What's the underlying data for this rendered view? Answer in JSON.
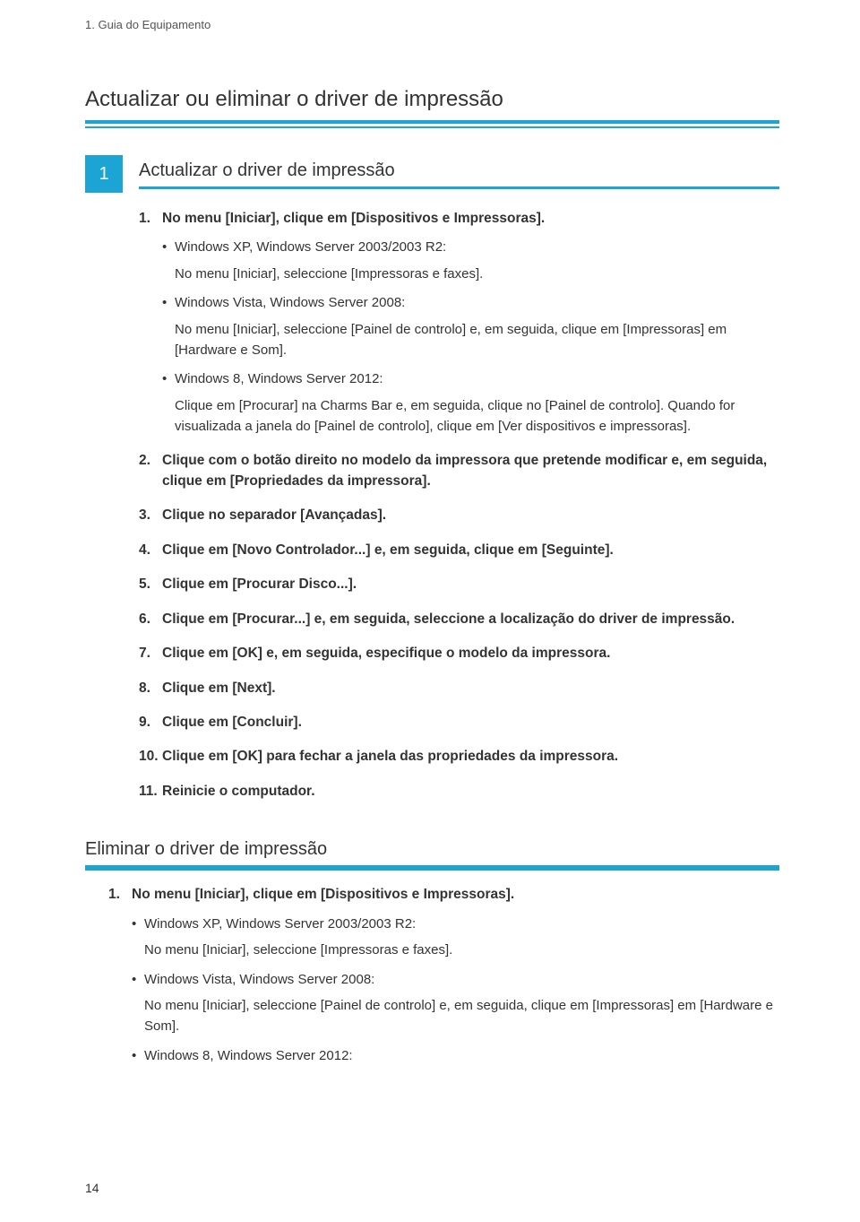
{
  "breadcrumb": "1. Guia do Equipamento",
  "main_title": "Actualizar ou eliminar o driver de impressão",
  "chapter_num": "1",
  "section1": {
    "title": "Actualizar o driver de impressão",
    "steps": [
      {
        "n": "1.",
        "t": "No menu [Iniciar], clique em [Dispositivos e Impressoras]."
      },
      {
        "n": "2.",
        "t": "Clique com o botão direito no modelo da impressora que pretende modificar e, em seguida, clique em [Propriedades da impressora]."
      },
      {
        "n": "3.",
        "t": "Clique no separador [Avançadas]."
      },
      {
        "n": "4.",
        "t": "Clique em [Novo Controlador...] e, em seguida, clique em [Seguinte]."
      },
      {
        "n": "5.",
        "t": "Clique em [Procurar Disco...]."
      },
      {
        "n": "6.",
        "t": "Clique em [Procurar...] e, em seguida, seleccione a localização do driver de impressão."
      },
      {
        "n": "7.",
        "t": "Clique em [OK] e, em seguida, especifique o modelo da impressora."
      },
      {
        "n": "8.",
        "t": "Clique em [Next]."
      },
      {
        "n": "9.",
        "t": "Clique em [Concluir]."
      },
      {
        "n": "10.",
        "t": "Clique em [OK] para fechar a janela das propriedades da impressora."
      },
      {
        "n": "11.",
        "t": "Reinicie o computador."
      }
    ],
    "bullets": [
      {
        "label": "Windows XP, Windows Server 2003/2003 R2:",
        "body": "No menu [Iniciar], seleccione [Impressoras e faxes]."
      },
      {
        "label": "Windows Vista, Windows Server 2008:",
        "body": "No menu [Iniciar], seleccione [Painel de controlo] e, em seguida, clique em [Impressoras] em [Hardware e Som]."
      },
      {
        "label": "Windows 8, Windows Server 2012:",
        "body": "Clique em [Procurar] na Charms Bar e, em seguida, clique no [Painel de controlo]. Quando for visualizada a janela do [Painel de controlo], clique em [Ver dispositivos e impressoras]."
      }
    ]
  },
  "section2": {
    "title": "Eliminar o driver de impressão",
    "step1": {
      "n": "1.",
      "t": "No menu [Iniciar], clique em [Dispositivos e Impressoras]."
    },
    "bullets": [
      {
        "label": "Windows XP, Windows Server 2003/2003 R2:",
        "body": "No menu [Iniciar], seleccione [Impressoras e faxes]."
      },
      {
        "label": "Windows Vista, Windows Server 2008:",
        "body": "No menu [Iniciar], seleccione [Painel de controlo] e, em seguida, clique em [Impressoras] em [Hardware e Som]."
      },
      {
        "label": "Windows 8, Windows Server 2012:",
        "body": ""
      }
    ]
  },
  "page_number": "14"
}
